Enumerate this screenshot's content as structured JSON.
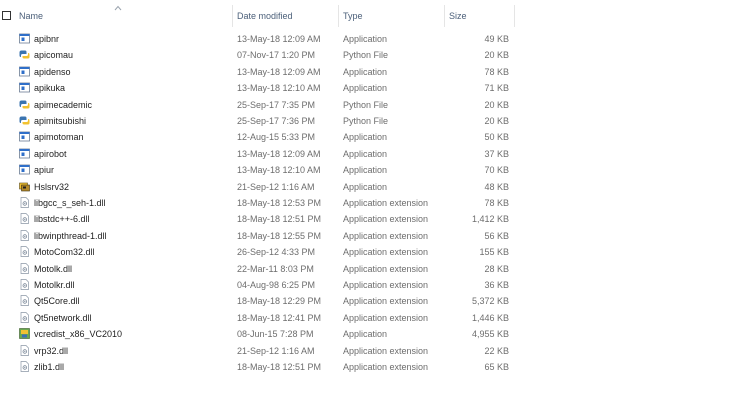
{
  "header": {
    "name": "Name",
    "date_modified": "Date modified",
    "type": "Type",
    "size": "Size"
  },
  "files": [
    {
      "name": "apibnr",
      "date": "13-May-18 12:09 AM",
      "type": "Application",
      "size": "49 KB",
      "icon": "application-icon"
    },
    {
      "name": "apicomau",
      "date": "07-Nov-17 1:20 PM",
      "type": "Python File",
      "size": "20 KB",
      "icon": "python-file-icon"
    },
    {
      "name": "apidenso",
      "date": "13-May-18 12:09 AM",
      "type": "Application",
      "size": "78 KB",
      "icon": "application-icon"
    },
    {
      "name": "apikuka",
      "date": "13-May-18 12:10 AM",
      "type": "Application",
      "size": "71 KB",
      "icon": "application-icon"
    },
    {
      "name": "apimecademic",
      "date": "25-Sep-17 7:35 PM",
      "type": "Python File",
      "size": "20 KB",
      "icon": "python-file-icon"
    },
    {
      "name": "apimitsubishi",
      "date": "25-Sep-17 7:36 PM",
      "type": "Python File",
      "size": "20 KB",
      "icon": "python-file-icon"
    },
    {
      "name": "apimotoman",
      "date": "12-Aug-15 5:33 PM",
      "type": "Application",
      "size": "50 KB",
      "icon": "application-icon"
    },
    {
      "name": "apirobot",
      "date": "13-May-18 12:09 AM",
      "type": "Application",
      "size": "37 KB",
      "icon": "application-icon"
    },
    {
      "name": "apiur",
      "date": "13-May-18 12:10 AM",
      "type": "Application",
      "size": "70 KB",
      "icon": "application-icon"
    },
    {
      "name": "Hslsrv32",
      "date": "21-Sep-12 1:16 AM",
      "type": "Application",
      "size": "48 KB",
      "icon": "hslsrv-app-icon"
    },
    {
      "name": "libgcc_s_seh-1.dll",
      "date": "18-May-18 12:53 PM",
      "type": "Application extension",
      "size": "78 KB",
      "icon": "dll-file-icon"
    },
    {
      "name": "libstdc++-6.dll",
      "date": "18-May-18 12:51 PM",
      "type": "Application extension",
      "size": "1,412 KB",
      "icon": "dll-file-icon"
    },
    {
      "name": "libwinpthread-1.dll",
      "date": "18-May-18 12:55 PM",
      "type": "Application extension",
      "size": "56 KB",
      "icon": "dll-file-icon"
    },
    {
      "name": "MotoCom32.dll",
      "date": "26-Sep-12 4:33 PM",
      "type": "Application extension",
      "size": "155 KB",
      "icon": "dll-file-icon"
    },
    {
      "name": "Motolk.dll",
      "date": "22-Mar-11 8:03 PM",
      "type": "Application extension",
      "size": "28 KB",
      "icon": "dll-file-icon"
    },
    {
      "name": "Motolkr.dll",
      "date": "04-Aug-98 6:25 PM",
      "type": "Application extension",
      "size": "36 KB",
      "icon": "dll-file-icon"
    },
    {
      "name": "Qt5Core.dll",
      "date": "18-May-18 12:29 PM",
      "type": "Application extension",
      "size": "5,372 KB",
      "icon": "dll-file-icon"
    },
    {
      "name": "Qt5network.dll",
      "date": "18-May-18 12:41 PM",
      "type": "Application extension",
      "size": "1,446 KB",
      "icon": "dll-file-icon"
    },
    {
      "name": "vcredist_x86_VC2010",
      "date": "08-Jun-15 7:28 PM",
      "type": "Application",
      "size": "4,955 KB",
      "icon": "installer-icon"
    },
    {
      "name": "vrp32.dll",
      "date": "21-Sep-12 1:16 AM",
      "type": "Application extension",
      "size": "22 KB",
      "icon": "dll-file-icon"
    },
    {
      "name": "zlib1.dll",
      "date": "18-May-18 12:51 PM",
      "type": "Application extension",
      "size": "65 KB",
      "icon": "dll-file-icon"
    }
  ],
  "colors": {
    "header_text": "#4c607a",
    "detail_text": "#6d6d6d",
    "name_text": "#1e1e1e",
    "app_icon_blue": "#2f6fc9",
    "python_blue": "#3b74b0",
    "python_yellow": "#f2c230"
  }
}
